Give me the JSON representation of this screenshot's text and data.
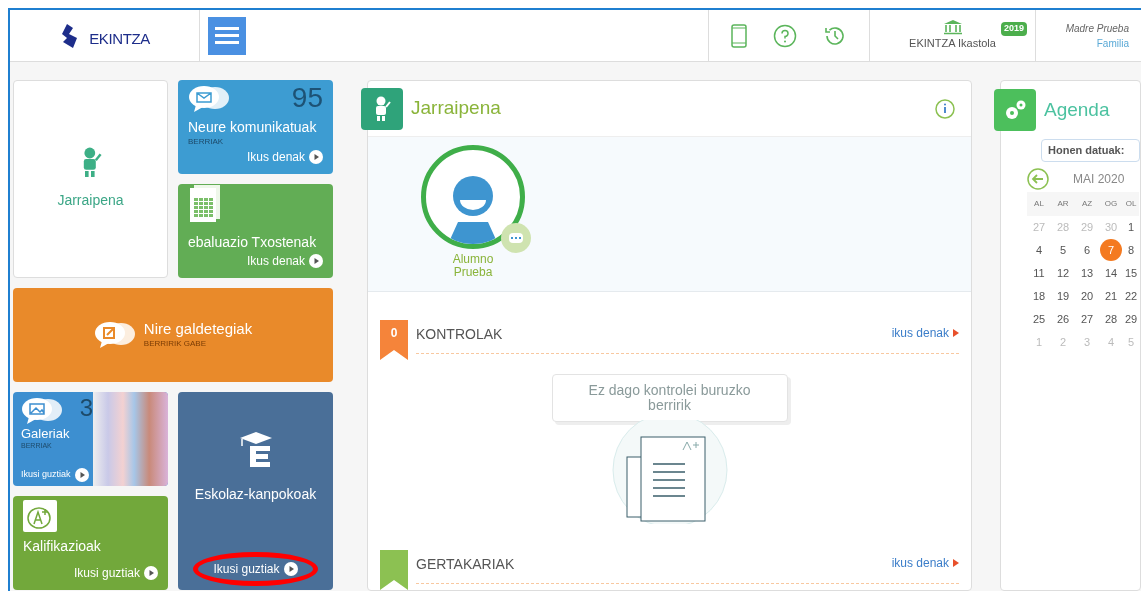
{
  "header": {
    "logo": "EKINTZA",
    "school": "EKINTZA Ikastola",
    "year": "2019",
    "user": "Madre Prueba",
    "role": "Familia"
  },
  "tiles": [
    {
      "kind": "profile",
      "title": "Jarraipena"
    },
    {
      "kind": "messages",
      "count": "95",
      "title": "Neure komunikatuak",
      "subtitle": "BERRIAK",
      "link": "Ikus denak"
    },
    {
      "kind": "reports",
      "title": "ebaluazio Txostenak",
      "link": "Ikus denak"
    },
    {
      "kind": "survey",
      "title": "Nire galdetegiak",
      "subtitle": "BERRIRIK GABE"
    },
    {
      "kind": "gallery",
      "count": "3",
      "title": "Galeriak",
      "subtitle": "BERRIAK",
      "link": "Ikusi guztiak"
    },
    {
      "kind": "grades",
      "title": "Kalifikazioak",
      "link": "Ikusi guztiak"
    },
    {
      "kind": "activities",
      "title": "Eskolaz-kanpokoak",
      "link": "Ikusi guztiak",
      "circled": true
    }
  ],
  "tracking": {
    "title": "Jarraipena",
    "student": "Alumno Prueba",
    "sections": [
      {
        "count": "0",
        "title": "KONTROLAK",
        "link": "ikus denak",
        "color": "#f5843a",
        "empty": "Ez dago kontrolei buruzko berririk"
      },
      {
        "title": "GERTAKARIAK",
        "link": "ikus denak",
        "color": "#8cc152"
      }
    ]
  },
  "agenda": {
    "title": "Agenda",
    "filter": "Honen datuak:",
    "month": "MAI 2020",
    "weekdays": [
      "AL",
      "AR",
      "AZ",
      "OG",
      "OL"
    ],
    "weeks": [
      [
        {
          "day": "27",
          "muted": true,
          "selected": false
        },
        {
          "day": "28",
          "muted": true,
          "selected": false
        },
        {
          "day": "29",
          "muted": true,
          "selected": false
        },
        {
          "day": "30",
          "muted": true,
          "selected": false
        },
        {
          "day": "1",
          "muted": false,
          "selected": false
        }
      ],
      [
        {
          "day": "4",
          "muted": false,
          "selected": false
        },
        {
          "day": "5",
          "muted": false,
          "selected": false
        },
        {
          "day": "6",
          "muted": false,
          "selected": false
        },
        {
          "day": "7",
          "muted": false,
          "selected": true
        },
        {
          "day": "8",
          "muted": false,
          "selected": false
        }
      ],
      [
        {
          "day": "11",
          "muted": false,
          "selected": false
        },
        {
          "day": "12",
          "muted": false,
          "selected": false
        },
        {
          "day": "13",
          "muted": false,
          "selected": false
        },
        {
          "day": "14",
          "muted": false,
          "selected": false
        },
        {
          "day": "15",
          "muted": false,
          "selected": false
        }
      ],
      [
        {
          "day": "18",
          "muted": false,
          "selected": false
        },
        {
          "day": "19",
          "muted": false,
          "selected": false
        },
        {
          "day": "20",
          "muted": false,
          "selected": false
        },
        {
          "day": "21",
          "muted": false,
          "selected": false
        },
        {
          "day": "22",
          "muted": false,
          "selected": false
        }
      ],
      [
        {
          "day": "25",
          "muted": false,
          "selected": false
        },
        {
          "day": "26",
          "muted": false,
          "selected": false
        },
        {
          "day": "27",
          "muted": false,
          "selected": false
        },
        {
          "day": "28",
          "muted": false,
          "selected": false
        },
        {
          "day": "29",
          "muted": false,
          "selected": false
        }
      ],
      [
        {
          "day": "1",
          "muted": true,
          "selected": false
        },
        {
          "day": "2",
          "muted": true,
          "selected": false
        },
        {
          "day": "3",
          "muted": true,
          "selected": false
        },
        {
          "day": "4",
          "muted": true,
          "selected": false
        },
        {
          "day": "5",
          "muted": true,
          "selected": false
        }
      ]
    ]
  }
}
